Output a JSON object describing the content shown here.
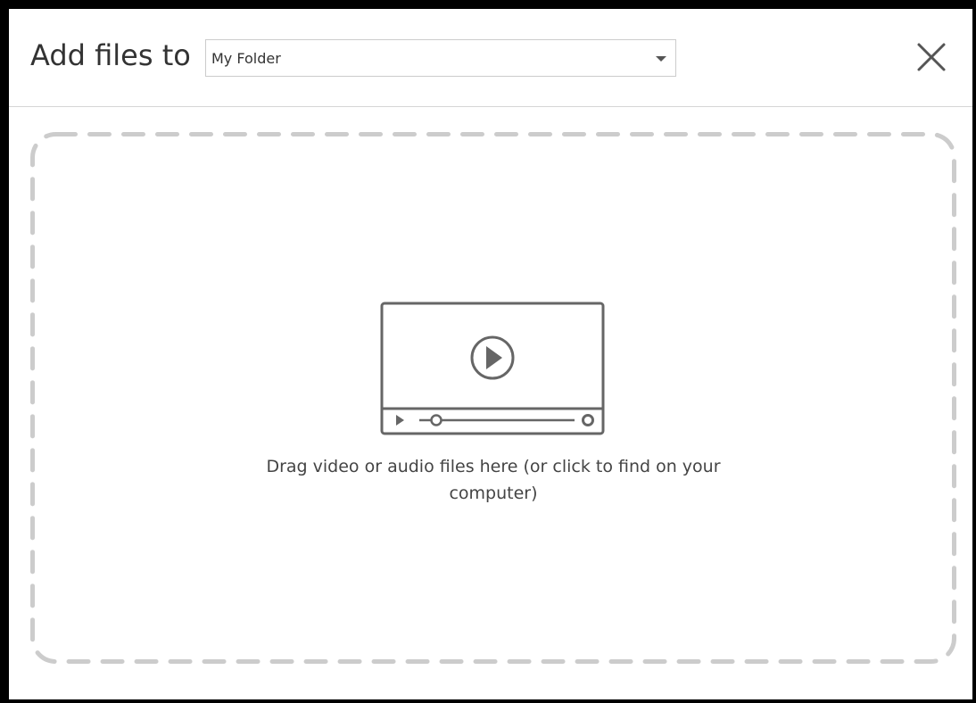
{
  "header": {
    "title": "Add files to",
    "folder_select": {
      "selected": "My Folder"
    },
    "close_icon": "close-icon"
  },
  "dropzone": {
    "icon": "video-player-icon",
    "text": "Drag video or audio files here (or click to find on your computer)"
  },
  "colors": {
    "dashed_border": "#cccccc",
    "icon_stroke": "#666666",
    "header_divider": "#d6d6d6",
    "text": "#333333"
  }
}
